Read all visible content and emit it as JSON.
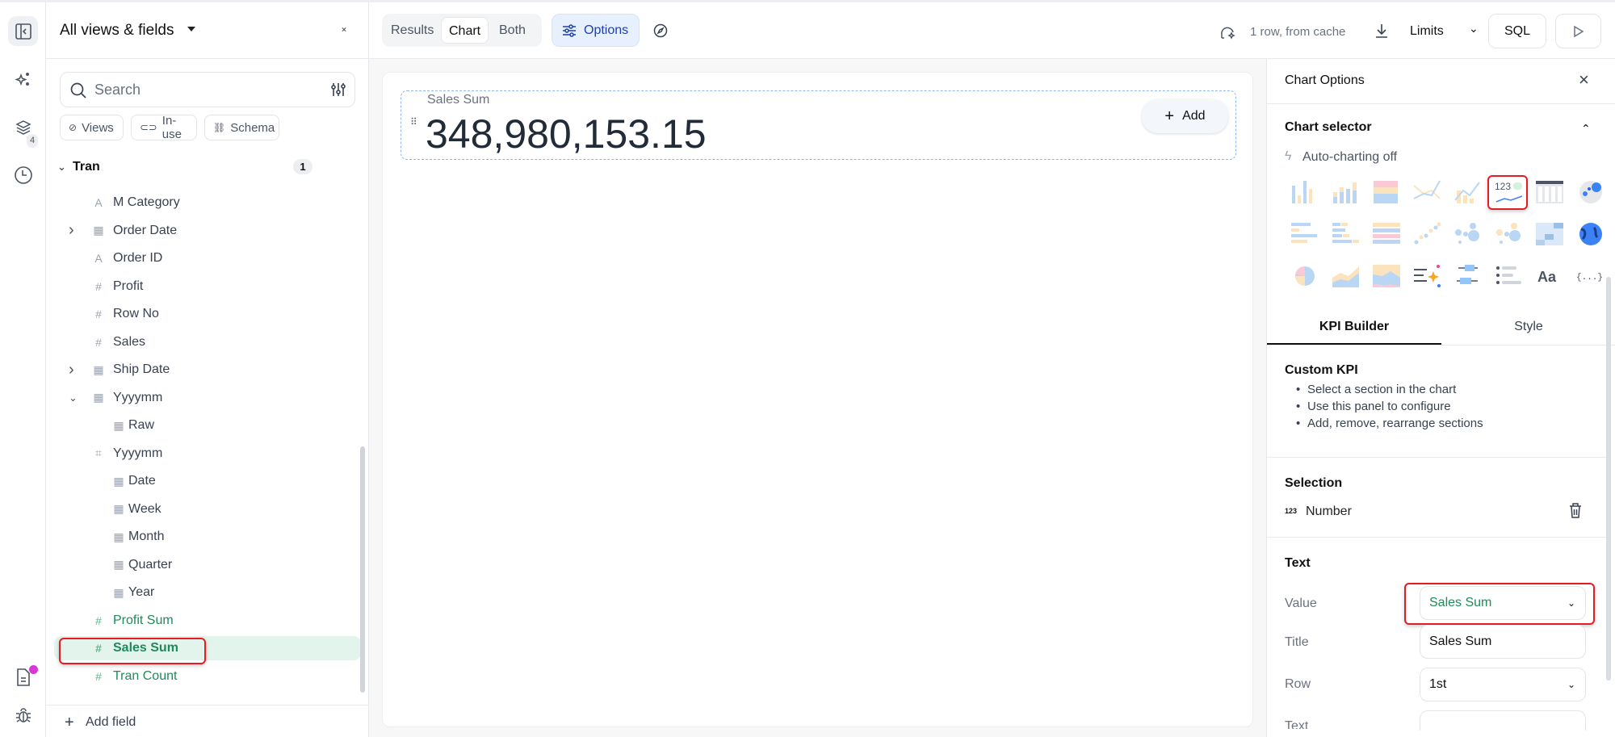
{
  "rail": {
    "layers_badge": "4"
  },
  "sidebar": {
    "title": "All views & fields",
    "search_placeholder": "Search",
    "chips": [
      "Views",
      "In-use",
      "Schema"
    ],
    "group": {
      "label": "Tran",
      "count": "1"
    },
    "fields": [
      {
        "label": "M Category",
        "icon": "text-icon",
        "level": 1
      },
      {
        "label": "Order Date",
        "icon": "calendar-icon",
        "level": 1,
        "chevron": "right"
      },
      {
        "label": "Order ID",
        "icon": "text-icon",
        "level": 1
      },
      {
        "label": "Profit",
        "icon": "hash-icon",
        "level": 1
      },
      {
        "label": "Row No",
        "icon": "hash-icon",
        "level": 1
      },
      {
        "label": "Sales",
        "icon": "hash-icon",
        "level": 1
      },
      {
        "label": "Ship Date",
        "icon": "calendar-icon",
        "level": 1,
        "chevron": "right"
      },
      {
        "label": "Yyyymm",
        "icon": "calendar-icon",
        "level": 1,
        "chevron": "down"
      },
      {
        "label": "Raw",
        "icon": "calendar-icon",
        "level": 2
      },
      {
        "label": "Yyyymm",
        "icon": "group-icon",
        "level": 1
      },
      {
        "label": "Date",
        "icon": "calendar-icon",
        "level": 2
      },
      {
        "label": "Week",
        "icon": "calendar-icon",
        "level": 2
      },
      {
        "label": "Month",
        "icon": "calendar-icon",
        "level": 2
      },
      {
        "label": "Quarter",
        "icon": "calendar-icon",
        "level": 2
      },
      {
        "label": "Year",
        "icon": "calendar-icon",
        "level": 2
      },
      {
        "label": "Profit Sum",
        "icon": "hash-icon",
        "level": 1,
        "measure": true
      },
      {
        "label": "Sales Sum",
        "icon": "hash-icon",
        "level": 1,
        "measure": true,
        "selected": true
      },
      {
        "label": "Tran Count",
        "icon": "hash-icon",
        "level": 1,
        "measure": true
      }
    ],
    "add_field": "Add field"
  },
  "toolbar": {
    "views": [
      "Results",
      "Chart",
      "Both"
    ],
    "active_view": "Chart",
    "options": "Options",
    "status": "1 row, from cache",
    "limits": "Limits",
    "sql": "SQL"
  },
  "kpi": {
    "title": "Sales Sum",
    "value": "348,980,153.15",
    "add": "Add"
  },
  "panel": {
    "title": "Chart Options",
    "selector_title": "Chart selector",
    "auto": "Auto-charting off",
    "chart_types": [
      "bar",
      "stacked-bar",
      "heat-bar",
      "line",
      "bar-line",
      "kpi",
      "table",
      "scatter-map",
      "hbar",
      "stacked-hbar",
      "heat-hbar",
      "scatter",
      "bubble",
      "bubble-color",
      "heatmap",
      "globe",
      "pie",
      "area",
      "stacked-area",
      "ai-insight",
      "boxplot",
      "list",
      "text",
      "custom"
    ],
    "selected_chart": "kpi",
    "tabs": [
      "KPI Builder",
      "Style"
    ],
    "custom_title": "Custom KPI",
    "bullets": [
      "Select a section in the chart",
      "Use this panel to configure",
      "Add, remove, rearrange sections"
    ],
    "selection_title": "Selection",
    "selection_item": "Number",
    "selection_icon_text": "123",
    "text_title": "Text",
    "fields": {
      "value_label": "Value",
      "value": "Sales Sum",
      "title_label": "Title",
      "title": "Sales Sum",
      "row_label": "Row",
      "row": "1st",
      "text_label": "Text"
    }
  },
  "colors": {
    "accent": "#1f8a5b",
    "blue": "#1e40af",
    "highlight": "#e51c23"
  }
}
